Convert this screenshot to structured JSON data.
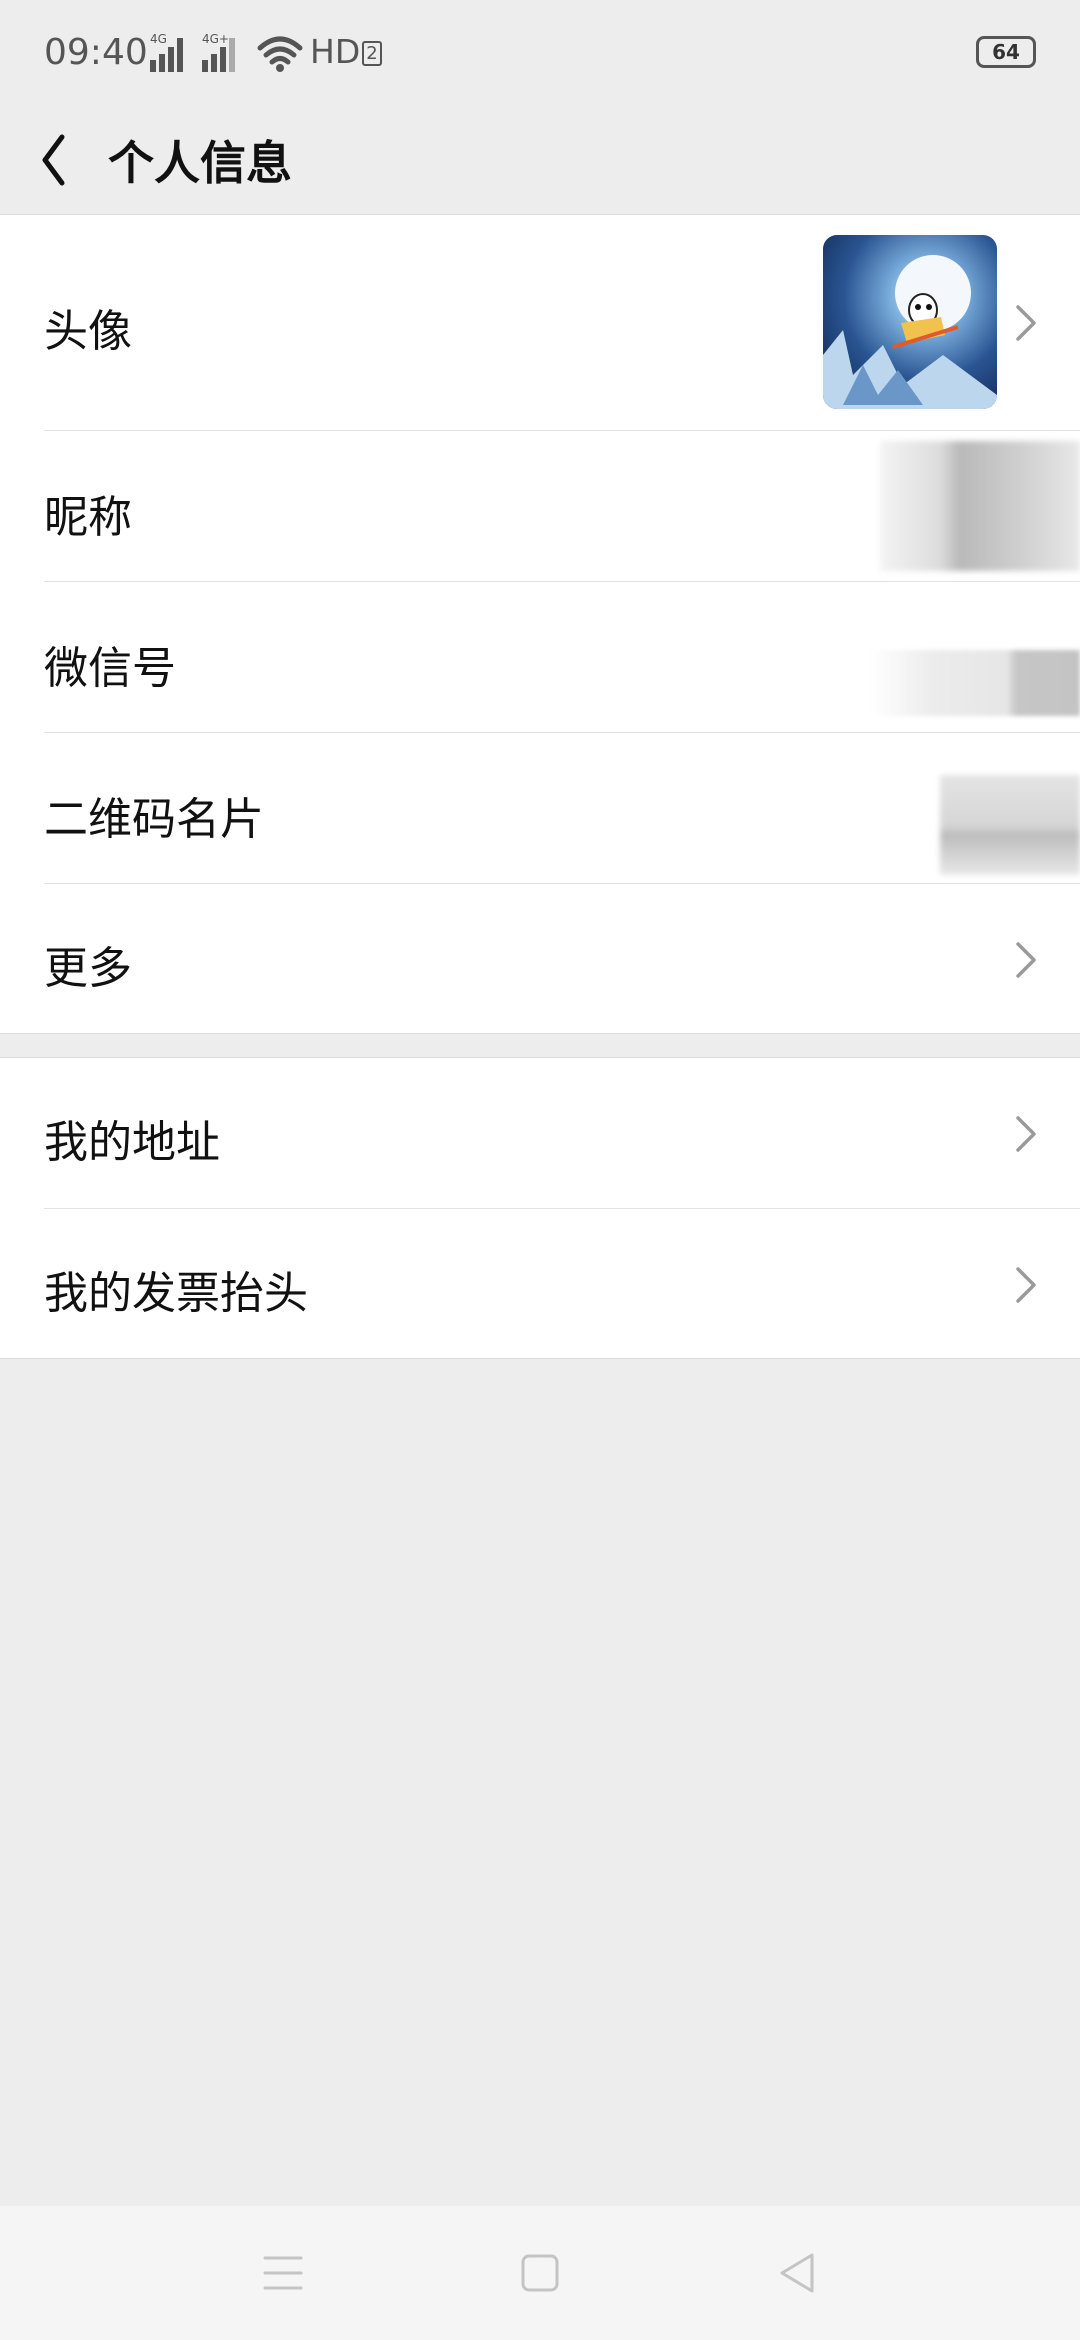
{
  "status_bar": {
    "time": "09:40",
    "network_labels": [
      "4G",
      "4G+"
    ],
    "hd_label": "HD",
    "hd_sub": "2",
    "battery": "64"
  },
  "nav": {
    "title": "个人信息",
    "back_icon": "chevron-left-icon"
  },
  "section1": [
    {
      "id": "avatar",
      "label": "头像"
    },
    {
      "id": "nickname",
      "label": "昵称"
    },
    {
      "id": "wechat_id",
      "label": "微信号"
    },
    {
      "id": "qr_card",
      "label": "二维码名片"
    },
    {
      "id": "more",
      "label": "更多"
    }
  ],
  "section2": [
    {
      "id": "my_address",
      "label": "我的地址"
    },
    {
      "id": "invoice_title",
      "label": "我的发票抬头"
    }
  ],
  "system_nav": {
    "icons": [
      "menu-icon",
      "home-icon",
      "back-triangle-icon"
    ]
  },
  "colors": {
    "background": "#ededed",
    "card": "#ffffff",
    "text": "#111111",
    "chevron": "#9a9a9a"
  }
}
